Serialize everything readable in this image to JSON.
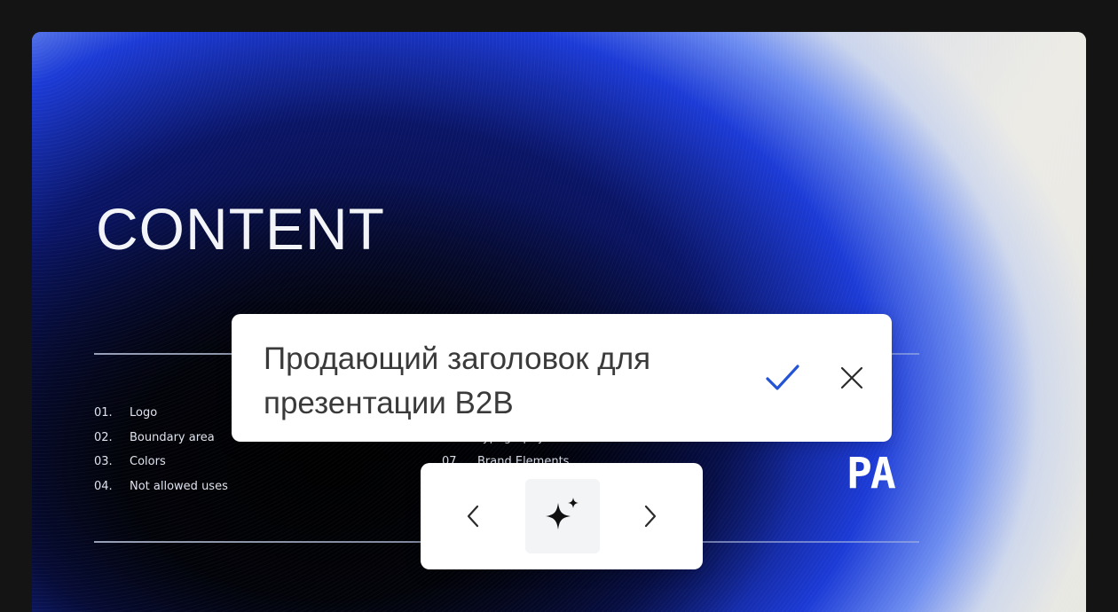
{
  "slide": {
    "title": "CONTENT",
    "toc_left": [
      {
        "num": "01.",
        "label": "Logo"
      },
      {
        "num": "02.",
        "label": "Boundary area"
      },
      {
        "num": "03.",
        "label": "Colors"
      },
      {
        "num": "04.",
        "label": "Not allowed uses"
      }
    ],
    "toc_right": [
      {
        "num": "06.",
        "label": "Typography"
      },
      {
        "num": "07.",
        "label": "Brand Elements"
      }
    ],
    "brand_mark": "PA"
  },
  "edit_popup": {
    "text": "Продающий заголовок для\nпрезентации B2B",
    "confirm_icon": "checkmark-icon",
    "cancel_icon": "close-icon",
    "accent_color": "#2354d6"
  },
  "nav_popup": {
    "prev_icon": "chevron-left-icon",
    "magic_icon": "sparkle-icon",
    "next_icon": "chevron-right-icon"
  }
}
